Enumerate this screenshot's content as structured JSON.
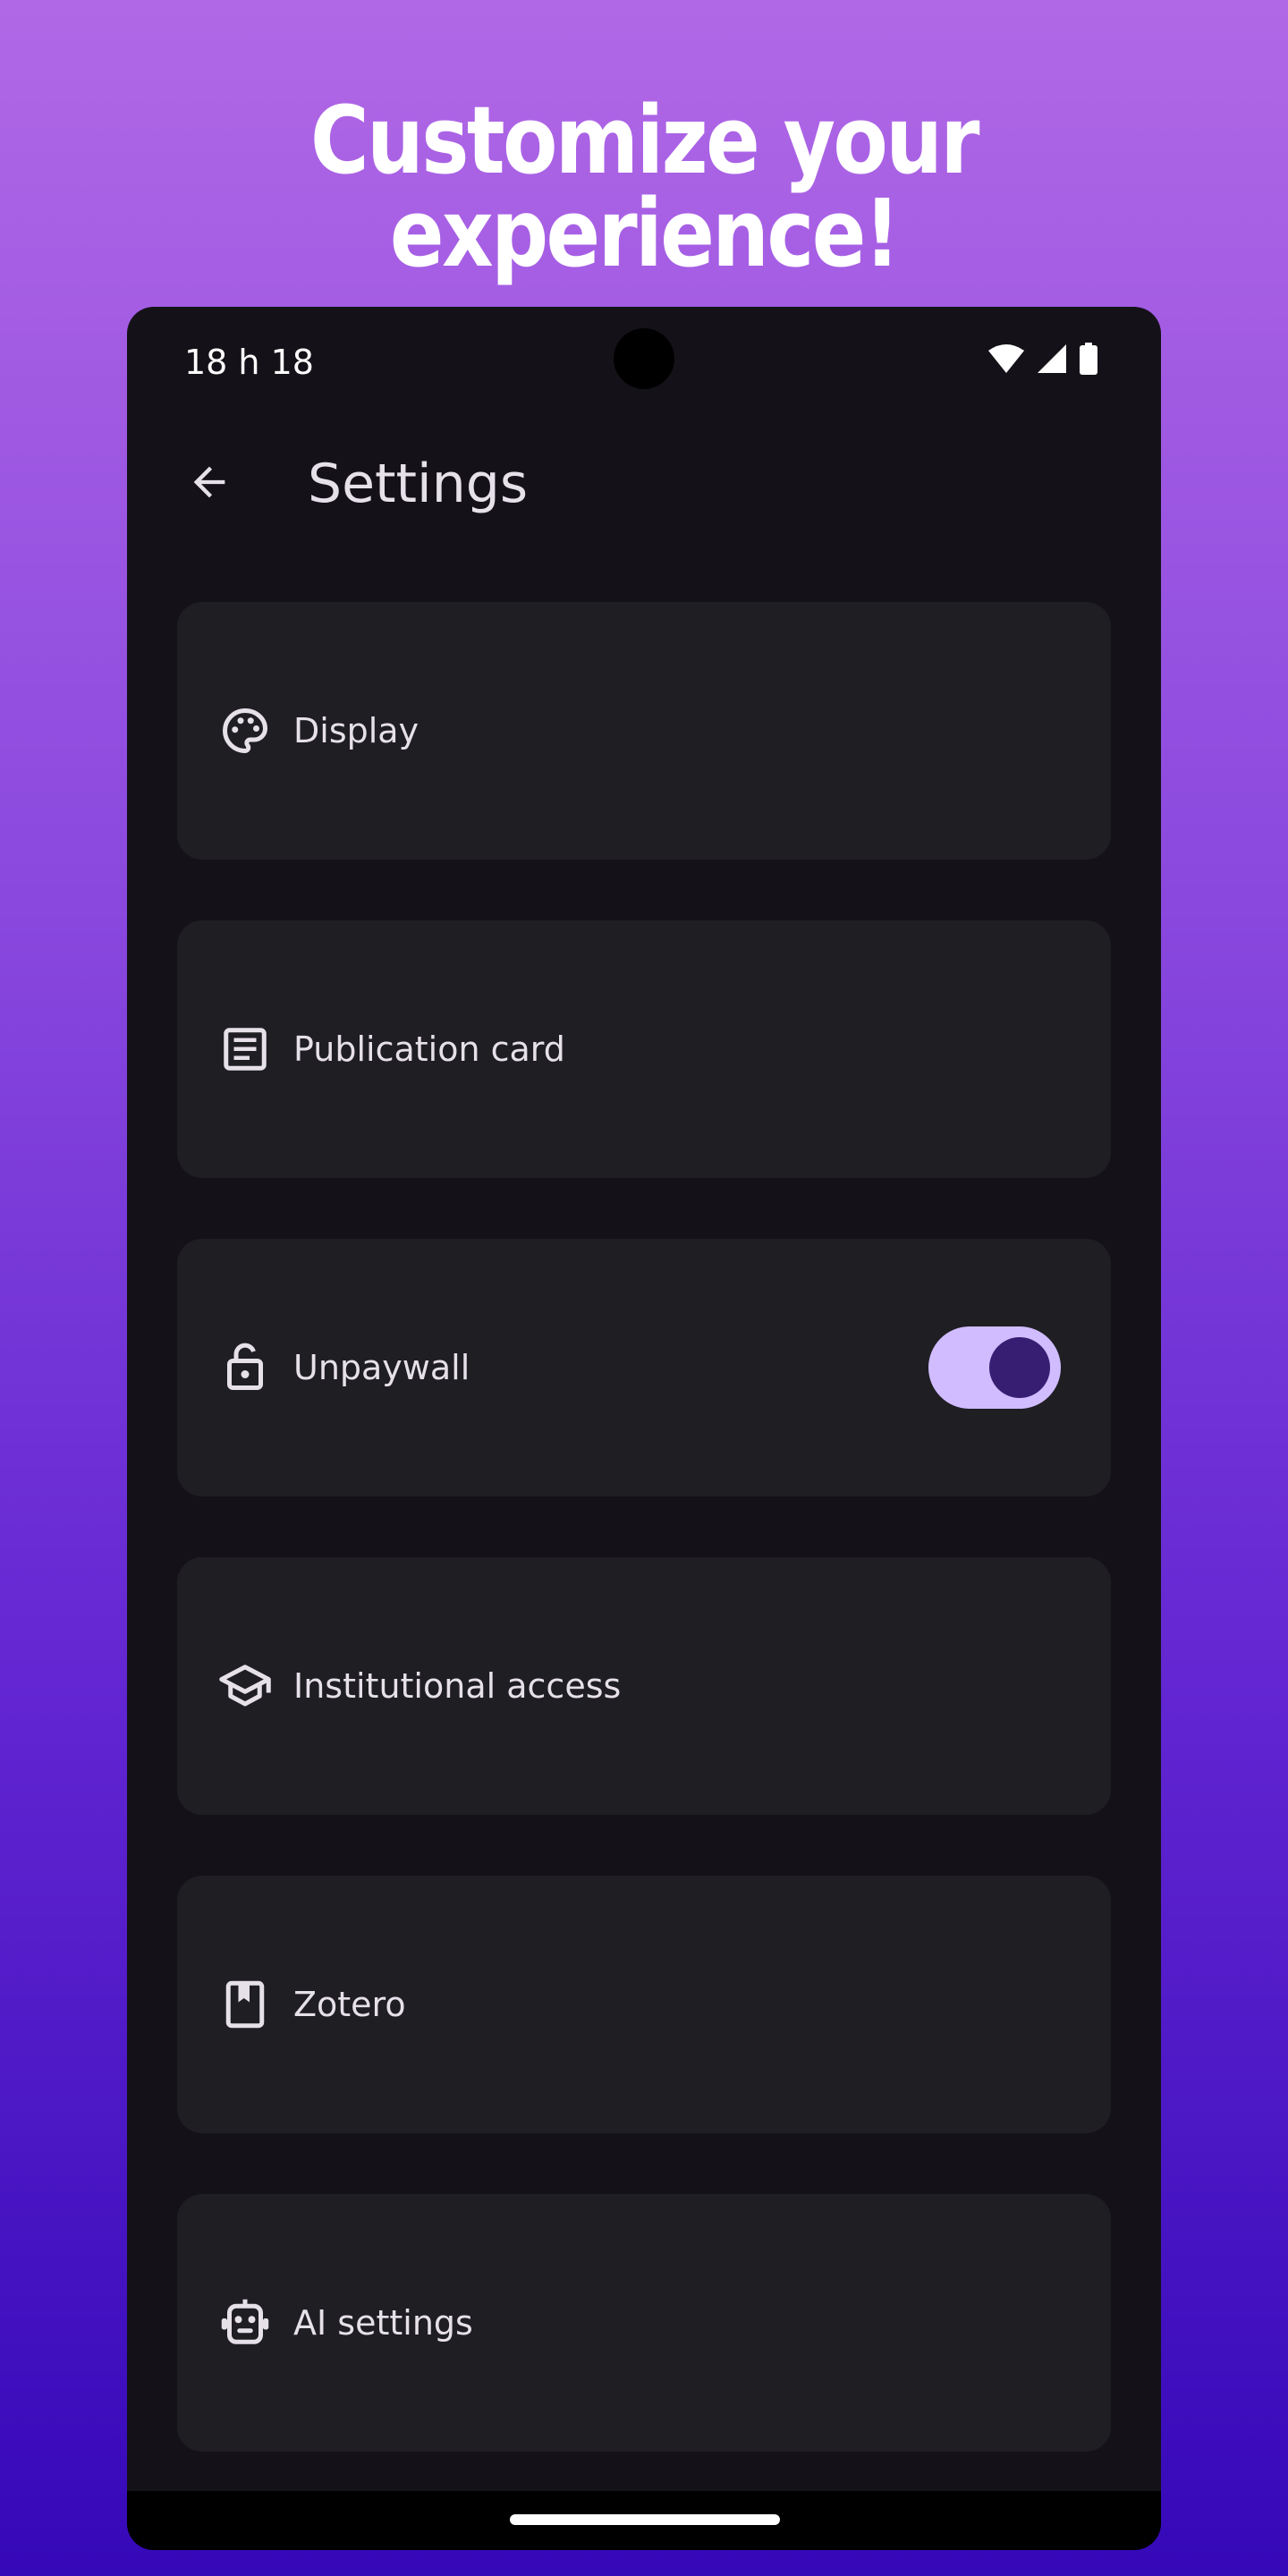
{
  "headline": "Customize your experience!",
  "status_bar": {
    "time": "18 h 18",
    "icons": [
      "wifi-icon",
      "signal-icon",
      "battery-icon"
    ]
  },
  "app_bar": {
    "back_icon": "arrow-back-icon",
    "title": "Settings"
  },
  "settings": [
    {
      "label": "Display",
      "icon": "palette-icon"
    },
    {
      "label": "Publication card",
      "icon": "article-icon"
    },
    {
      "label": "Unpaywall",
      "icon": "lock-open-icon",
      "toggle": true
    },
    {
      "label": "Institutional access",
      "icon": "school-icon"
    },
    {
      "label": "Zotero",
      "icon": "bookmark-book-icon"
    },
    {
      "label": "AI settings",
      "icon": "robot-icon"
    }
  ],
  "colors": {
    "background_top": "#b168e6",
    "background_bottom": "#3508b8",
    "phone_background": "#141218",
    "card_background": "#1f1e23",
    "text_primary": "#e6e0e9",
    "toggle_track": "#d0bcff",
    "toggle_thumb": "#381e72"
  }
}
